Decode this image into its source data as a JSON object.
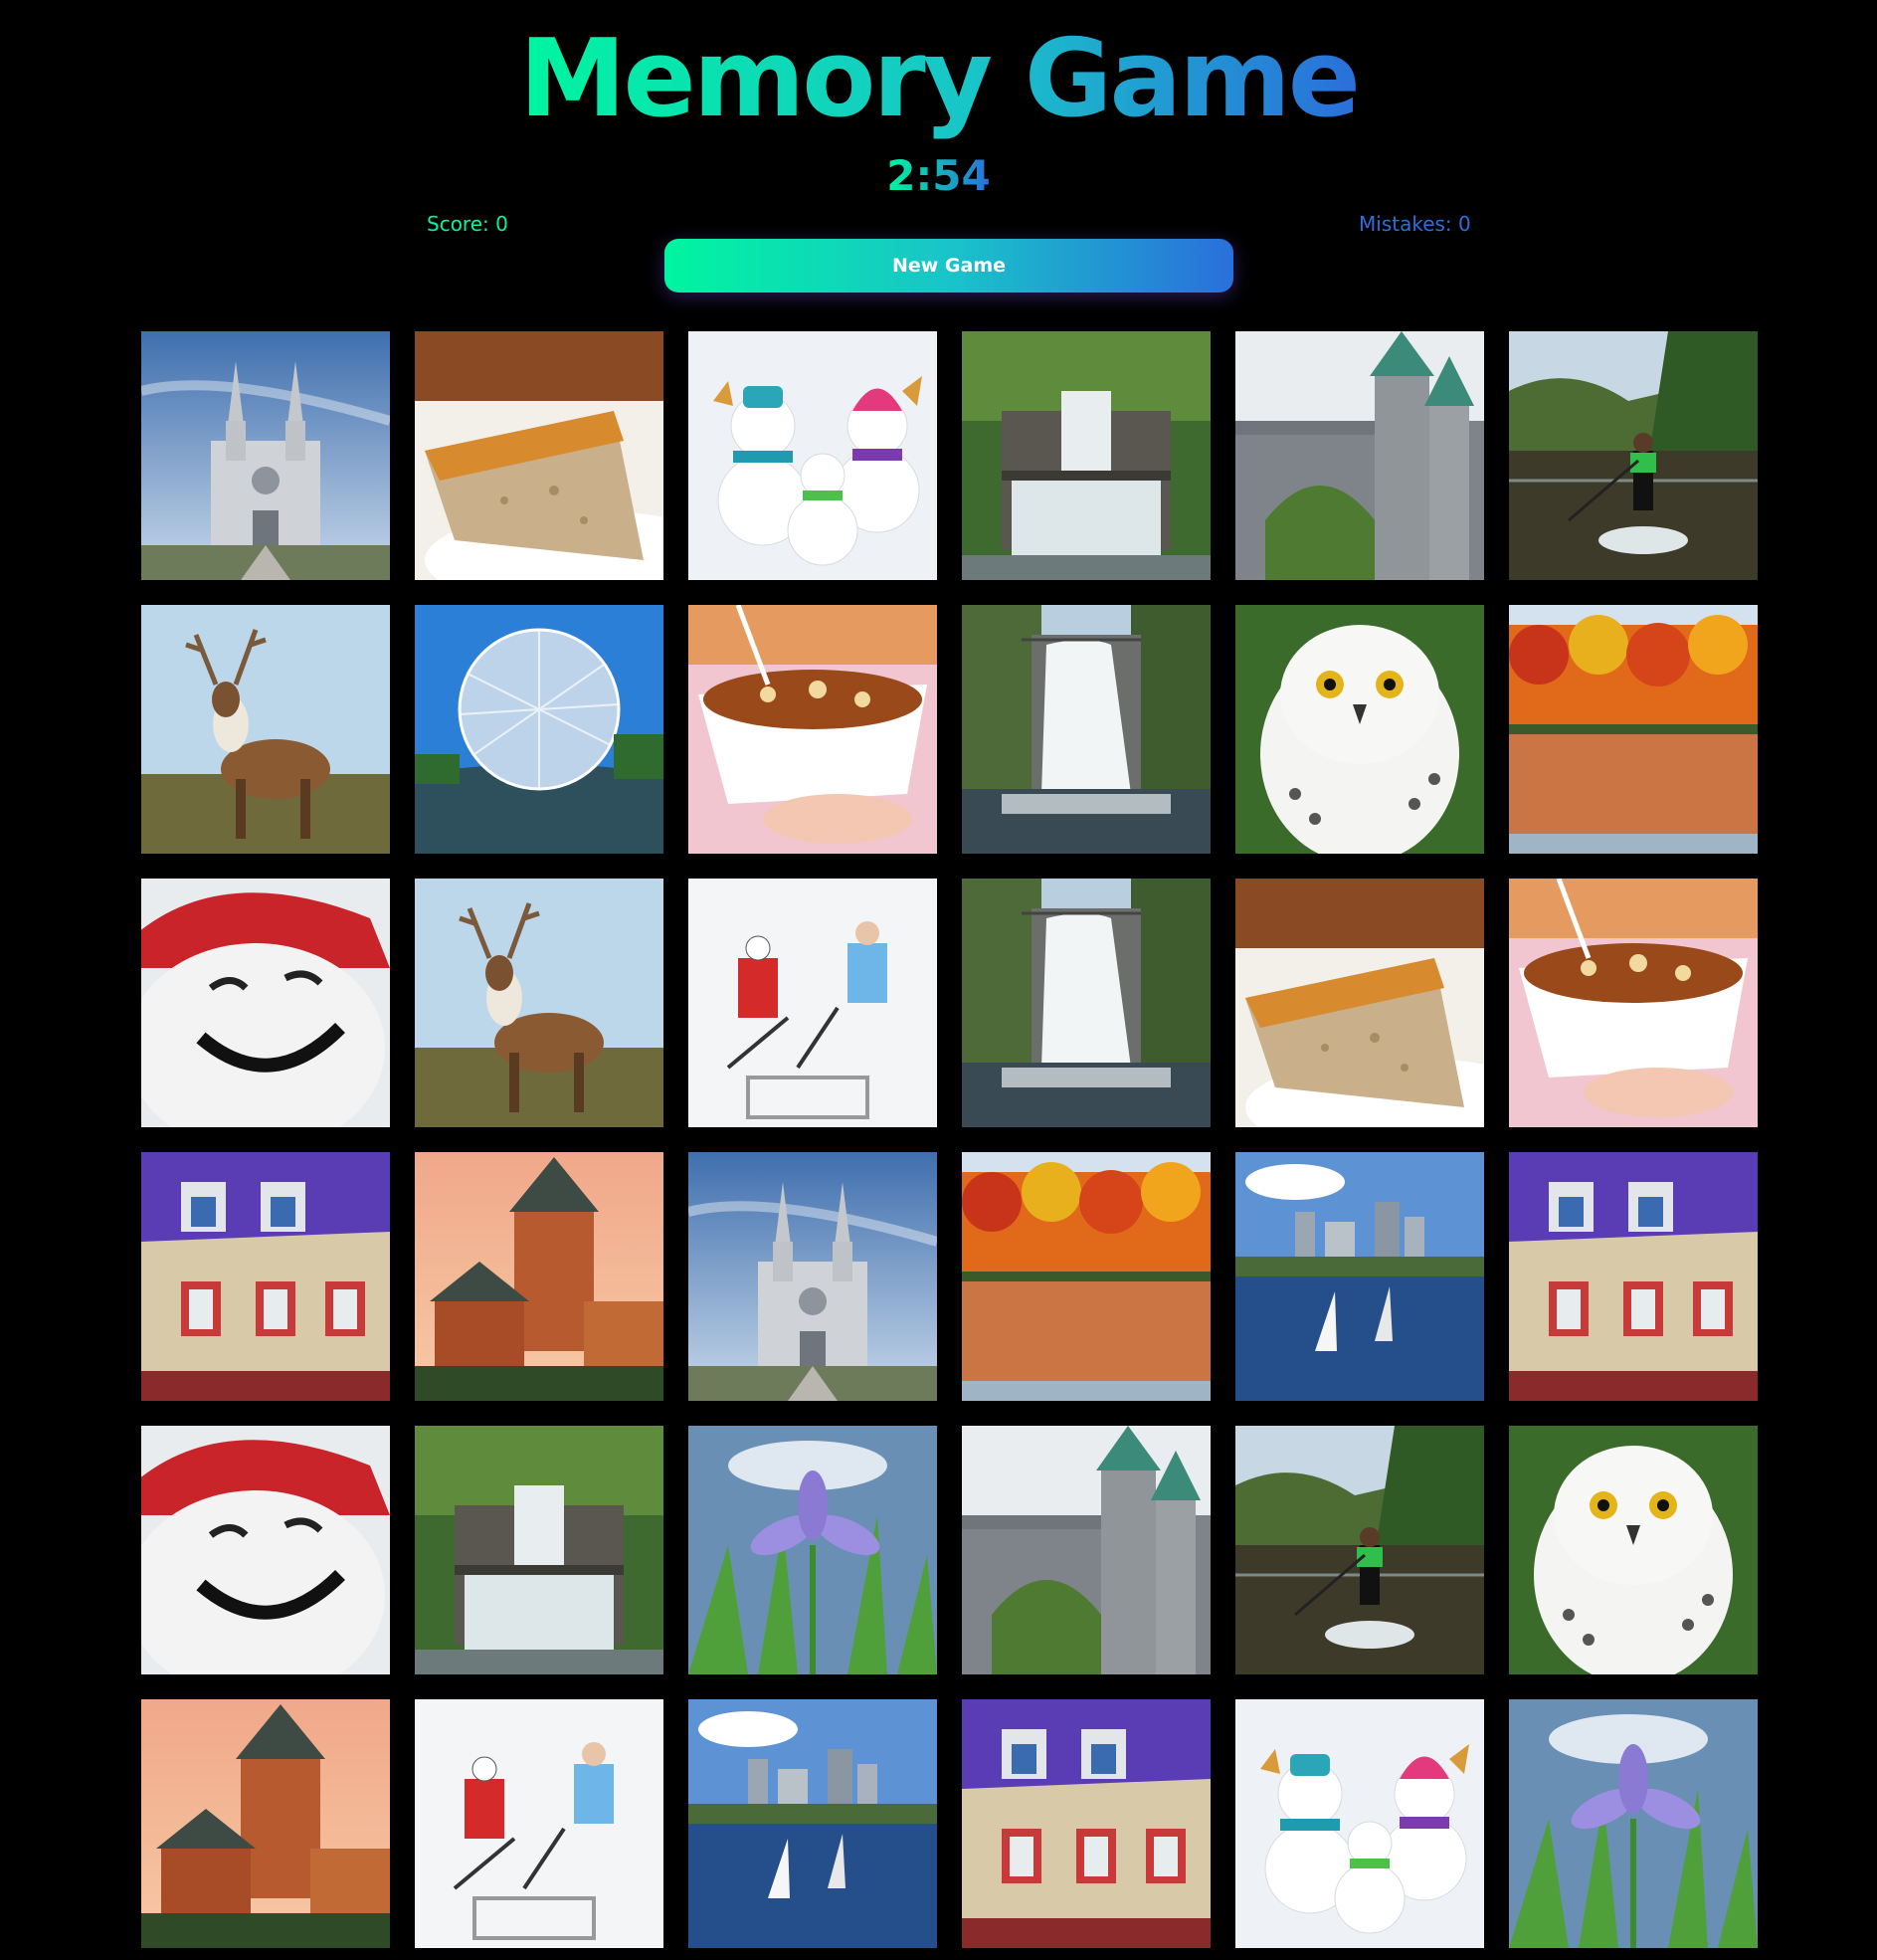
{
  "game": {
    "title": "Memory Game",
    "timer": "2:54",
    "score_label": "Score: 0",
    "mistakes_label": "Mistakes: 0",
    "new_game_label": "New Game"
  },
  "colors": {
    "background": "#000000",
    "gradient_start": "#00f5a0",
    "gradient_end": "#2a6fdb"
  },
  "cards": [
    "cathedral",
    "sugar-pie",
    "snowmen",
    "cascade-waterfall",
    "stone-gate",
    "paddleboarder",
    "caribou",
    "biosphere",
    "poutine",
    "montmorency-falls",
    "snowy-owl",
    "autumn-forest",
    "bonhomme",
    "caribou",
    "hockey-players",
    "montmorency-falls",
    "sugar-pie",
    "poutine",
    "colorful-house",
    "chateau-frontenac",
    "cathedral",
    "autumn-forest",
    "quebec-skyline",
    "colorful-house",
    "bonhomme",
    "cascade-waterfall",
    "blue-flag-iris",
    "stone-gate",
    "paddleboarder",
    "snowy-owl",
    "chateau-frontenac",
    "hockey-players",
    "quebec-skyline",
    "colorful-house",
    "snowmen",
    "blue-flag-iris"
  ]
}
